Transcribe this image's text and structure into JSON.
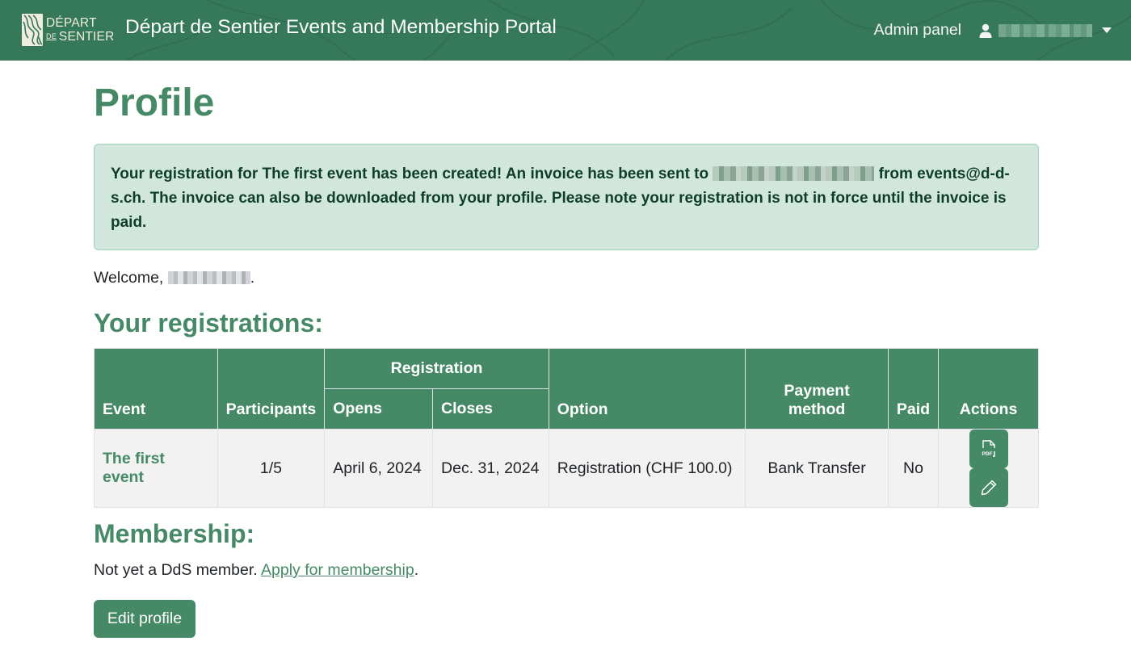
{
  "navbar": {
    "logo_line1": "DÉPART",
    "logo_de": "DE",
    "logo_line2": "SENTIER",
    "app_title": "Départ de Sentier Events and Membership Portal",
    "admin_label": "Admin panel",
    "user_icon": "user-icon",
    "user_menu_caret": "caret-down-icon"
  },
  "page": {
    "title": "Profile",
    "alert": {
      "part1": "Your registration for The first event has been created! An invoice has been sent to ",
      "part2": " from events@d-d-s.ch. The invoice can also be downloaded from your profile. Please note your registration is not in force until the invoice is paid."
    },
    "welcome_prefix": "Welcome, ",
    "welcome_suffix": "."
  },
  "registrations": {
    "title": "Your registrations:",
    "headers": {
      "event": "Event",
      "participants": "Participants",
      "registration_group": "Registration",
      "opens": "Opens",
      "closes": "Closes",
      "option": "Option",
      "payment_method": "Payment method",
      "paid": "Paid",
      "actions": "Actions"
    },
    "rows": [
      {
        "event": "The first event",
        "participants": "1/5",
        "opens": "April 6, 2024",
        "closes": "Dec. 31, 2024",
        "option": "Registration (CHF 100.0)",
        "payment_method": "Bank Transfer",
        "paid": "No",
        "actions": [
          "pdf-download-icon",
          "pencil-edit-icon"
        ]
      }
    ]
  },
  "membership": {
    "title": "Membership:",
    "text": "Not yet a DdS member. ",
    "link": "Apply for membership",
    "suffix": "."
  },
  "edit_profile_label": "Edit profile",
  "colors": {
    "brand_green": "#35795a",
    "accent_green": "#458966",
    "alert_bg": "#d1e7dd"
  }
}
